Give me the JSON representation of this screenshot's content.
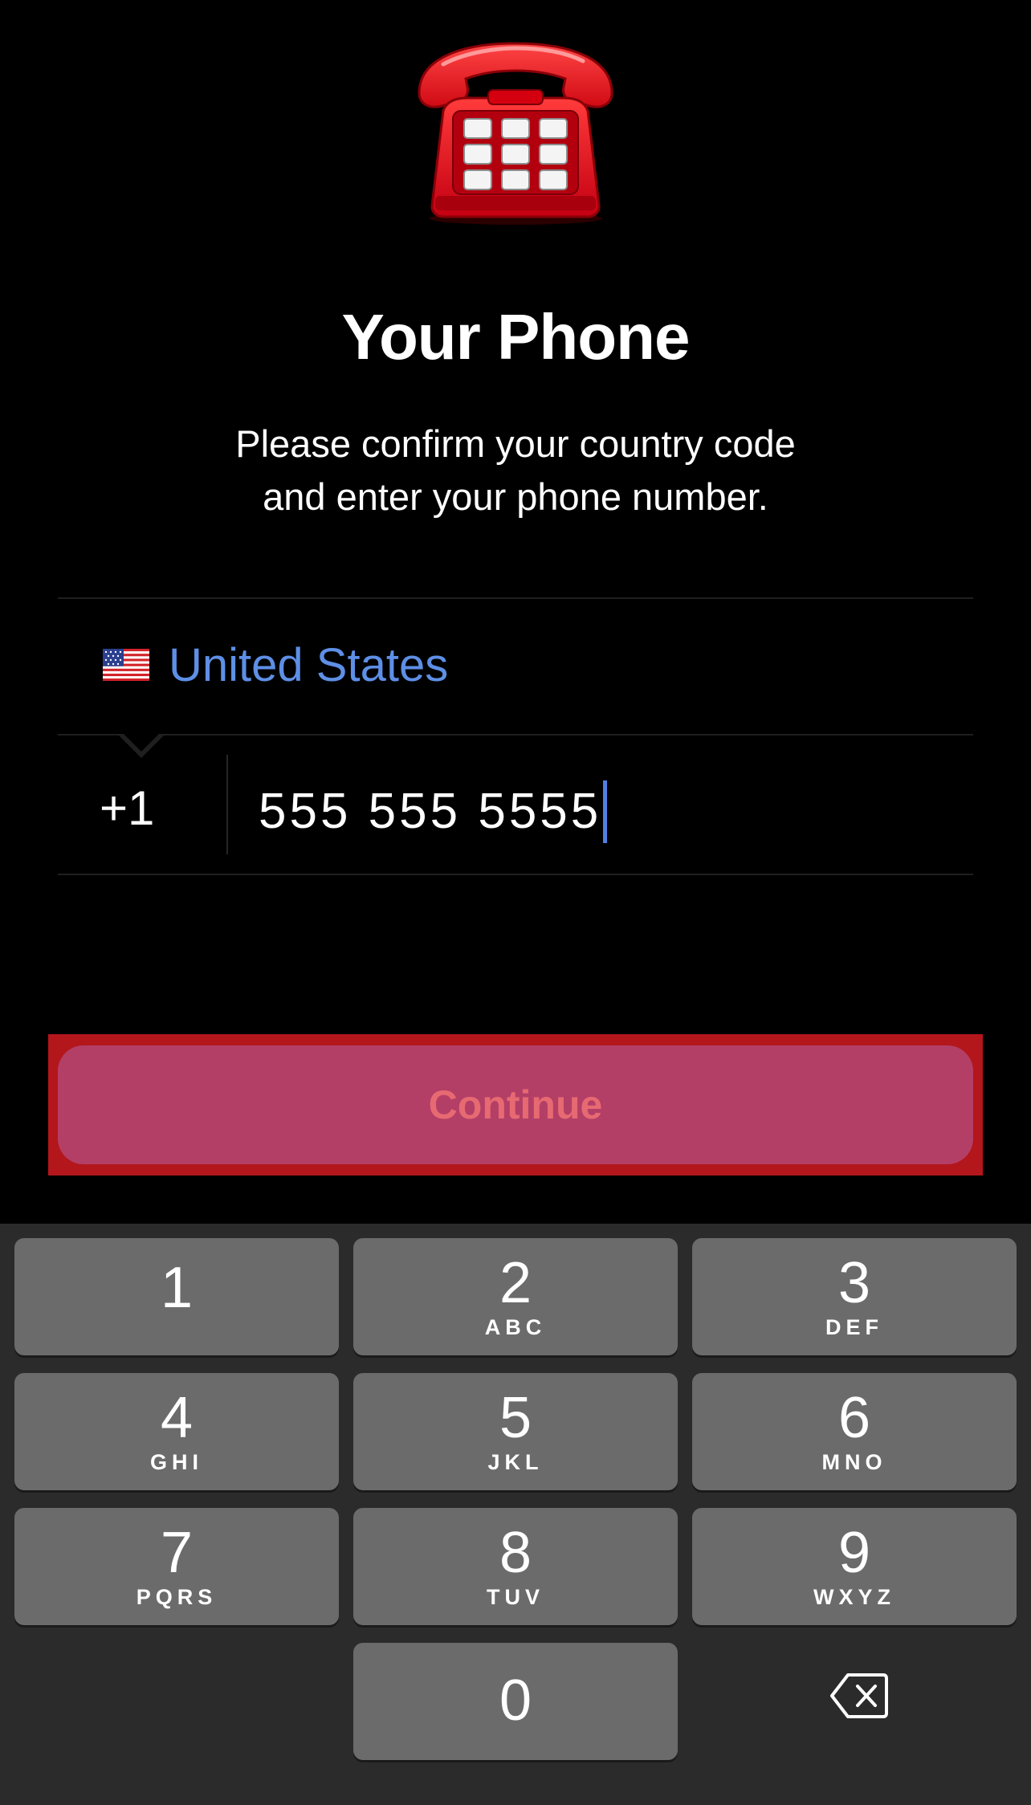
{
  "header": {
    "title": "Your Phone",
    "subtitle_line1": "Please confirm your country code",
    "subtitle_line2": "and enter your phone number.",
    "hero_icon": "telephone-emoji"
  },
  "form": {
    "country": {
      "flag_icon": "us-flag-icon",
      "name": "United States"
    },
    "phone": {
      "country_code": "+1",
      "number": "555 555 5555"
    }
  },
  "actions": {
    "continue_label": "Continue"
  },
  "keypad": {
    "keys": [
      {
        "digit": "1",
        "letters": ""
      },
      {
        "digit": "2",
        "letters": "ABC"
      },
      {
        "digit": "3",
        "letters": "DEF"
      },
      {
        "digit": "4",
        "letters": "GHI"
      },
      {
        "digit": "5",
        "letters": "JKL"
      },
      {
        "digit": "6",
        "letters": "MNO"
      },
      {
        "digit": "7",
        "letters": "PQRS"
      },
      {
        "digit": "8",
        "letters": "TUV"
      },
      {
        "digit": "9",
        "letters": "WXYZ"
      },
      {
        "digit": "0",
        "letters": ""
      }
    ],
    "backspace_icon": "backspace-icon"
  },
  "colors": {
    "background": "#000000",
    "accent": "#5e8fe6",
    "continue_button": "#b33f67",
    "continue_text": "#e76a72",
    "highlight_border": "#b3161b",
    "key": "#6b6b6b",
    "keypad_background": "#2b2b2b"
  }
}
